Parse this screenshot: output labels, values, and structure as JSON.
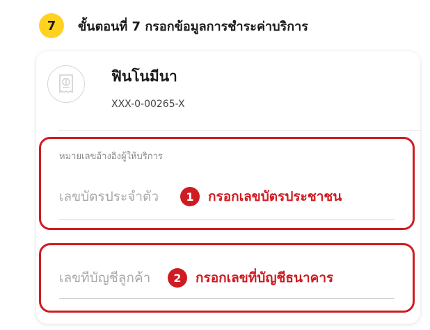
{
  "step": {
    "number": "7",
    "title": "ขั้นตอนที่ 7  กรอกข้อมูลการชำระค่าบริการ"
  },
  "biller": {
    "icon": "receipt-icon",
    "name": "ฟินโนมีนา",
    "code": "XXX-0-00265-X"
  },
  "fields": {
    "ref1": {
      "label": "หมายเลขอ้างอิงผู้ให้บริการ",
      "value": "",
      "placeholder": "เลขบัตรประจำตัว",
      "hint_number": "1",
      "hint_text": "กรอกเลขบัตรประชาชน"
    },
    "ref2": {
      "value": "",
      "placeholder": "เลขที่บัญชีลูกค้า",
      "hint_number": "2",
      "hint_text": "กรอกเลขที่บัญชีธนาคาร"
    }
  },
  "colors": {
    "step_badge": "#ffd21f",
    "highlight": "#cf1b22"
  }
}
